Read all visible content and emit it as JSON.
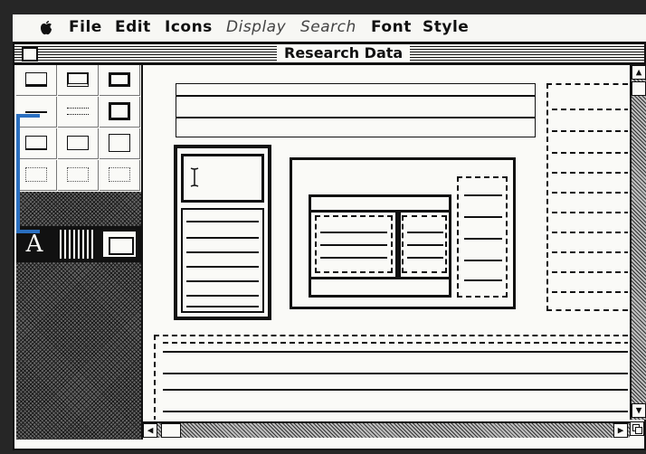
{
  "menubar": {
    "items": [
      {
        "label": "File",
        "enabled": true
      },
      {
        "label": "Edit",
        "enabled": true
      },
      {
        "label": "Icons",
        "enabled": true
      },
      {
        "label": "Display",
        "enabled": false
      },
      {
        "label": "Search",
        "enabled": false
      },
      {
        "label": "Font",
        "enabled": true
      },
      {
        "label": "Style",
        "enabled": true
      }
    ]
  },
  "window": {
    "title": "Research Data"
  },
  "palette": {
    "text_tool_glyph": "A"
  },
  "colors": {
    "selection_bracket": "#2a6fc0",
    "ink": "#111111",
    "paper": "#fafaf7"
  }
}
